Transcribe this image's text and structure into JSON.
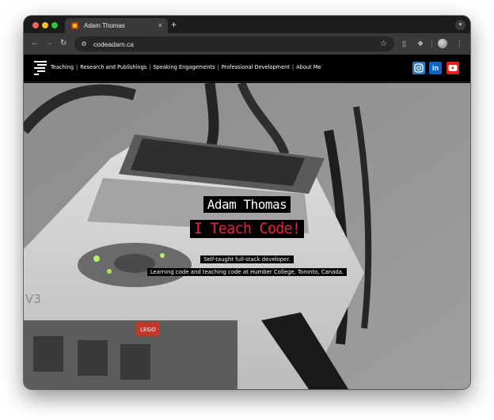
{
  "browser": {
    "tab_title": "Adam Thomas",
    "tab_close": "×",
    "new_tab": "+",
    "url": "codeadam.ca",
    "icons": [
      "back-arrow-icon",
      "forward-arrow-icon",
      "reload-icon",
      "site-info-icon",
      "star-icon",
      "extension-icon",
      "puzzle-icon",
      "avatar",
      "menu-icon",
      "tab-search-icon"
    ]
  },
  "site": {
    "nav": [
      {
        "label": "Teaching"
      },
      {
        "label": "Research and Publishings"
      },
      {
        "label": "Speaking Engagements"
      },
      {
        "label": "Professional Development"
      },
      {
        "label": "About Me"
      }
    ],
    "separator": "|",
    "social": [
      "instagram-icon",
      "linkedin-icon",
      "youtube-icon"
    ],
    "linkedin_text": "in"
  },
  "hero": {
    "name": "Adam Thomas",
    "tagline": "I Teach Code!",
    "line1": "Self-taught full-stack developer.",
    "line2": "Learning code and teaching code at Humber College, Toronto, Canada.",
    "device_label": "V3",
    "brand_label": "LEGO"
  },
  "colors": {
    "tagline": "#e8233d",
    "nav_bg": "#000000",
    "instagram": "#2f7bbf",
    "linkedin": "#0a66c2",
    "youtube": "#e62117"
  }
}
